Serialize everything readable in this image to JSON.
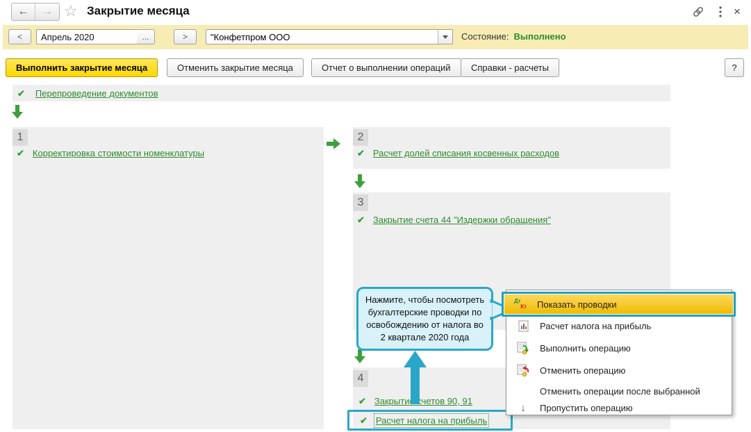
{
  "window": {
    "title": "Закрытие месяца",
    "back_glyph": "←",
    "forward_glyph": "→",
    "star_glyph": "☆",
    "close_glyph": "×"
  },
  "toolbar": {
    "prev_label": "<",
    "next_label": ">",
    "ellipsis_label": "...",
    "period_value": "Апрель 2020",
    "org_value": "\"Конфетпром ООО",
    "status_label": "Состояние:",
    "status_value": "Выполнено"
  },
  "actions": {
    "execute": "Выполнить закрытие месяца",
    "cancel": "Отменить закрытие месяца",
    "report": "Отчет о выполнении операций",
    "certificates": "Справки - расчеты",
    "help": "?"
  },
  "reposting": {
    "label": "Перепроведение документов"
  },
  "blocks": [
    {
      "number": "1",
      "items": [
        {
          "label": "Корректировка стоимости номенклатуры"
        }
      ]
    },
    {
      "number": "2",
      "items": [
        {
          "label": "Расчет долей списания косвенных расходов"
        }
      ]
    },
    {
      "number": "3",
      "items": [
        {
          "label": "Закрытие счета 44 \"Издержки обращения\""
        }
      ]
    },
    {
      "number": "4",
      "items": [
        {
          "label": "Закрытие счетов 90, 91"
        },
        {
          "label": "Расчет налога на прибыль",
          "highlighted": true
        }
      ]
    }
  ],
  "callout": {
    "text": "Нажмите, чтобы посмотреть бухгалтерские проводки по освобождению от налога во 2 квартале 2020 года"
  },
  "context_menu": {
    "items": [
      {
        "label": "Показать проводки",
        "icon": "dt-kt-icon",
        "highlighted": true
      },
      {
        "label": "Расчет налога на прибыль",
        "icon": "report-icon"
      },
      {
        "label": "Выполнить операцию",
        "icon": "execute-operation-icon"
      },
      {
        "label": "Отменить операцию",
        "icon": "cancel-operation-icon"
      },
      {
        "label": "Отменить операции после выбранной",
        "icon": ""
      },
      {
        "label": "Пропустить операцию",
        "icon": "skip-operation-icon"
      }
    ],
    "dtkt_glyphs": {
      "dt": "Дт",
      "kt": "Кт"
    },
    "skip_glyph": "↓"
  },
  "colors": {
    "band_yellow": "#f7ecb4",
    "primary_button_yellow": "#ffd800",
    "menu_highlight_gold": "#eebb00",
    "accent_teal": "#2aa7c8",
    "callout_fill": "#d9f1f9",
    "green": "#2e8b2e",
    "check_green": "#3da03d",
    "panel_gray": "#efefef",
    "badge_gray": "#dbdbdb"
  }
}
